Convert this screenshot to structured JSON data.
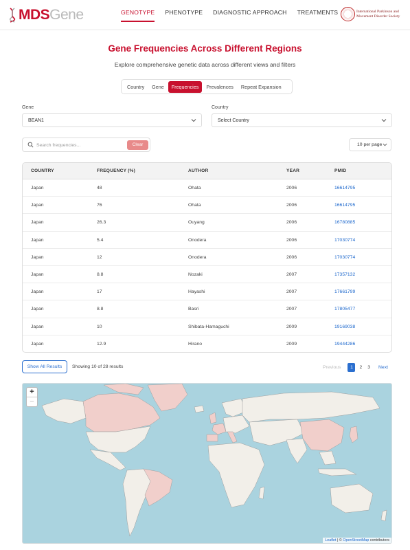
{
  "header": {
    "logo_primary": "MDS",
    "logo_secondary": "Gene",
    "nav": [
      {
        "label": "GENOTYPE",
        "active": true
      },
      {
        "label": "PHENOTYPE",
        "active": false
      },
      {
        "label": "DIAGNOSTIC APPROACH",
        "active": false
      },
      {
        "label": "TREATMENTS",
        "active": false
      }
    ],
    "society": "International Parkinson and Movement Disorder Society"
  },
  "page": {
    "title": "Gene Frequencies Across Different Regions",
    "subtitle": "Explore comprehensive genetic data across different views and filters"
  },
  "tabs": [
    {
      "label": "Country",
      "active": false
    },
    {
      "label": "Gene",
      "active": false
    },
    {
      "label": "Frequencies",
      "active": true
    },
    {
      "label": "Prevalences",
      "active": false
    },
    {
      "label": "Repeat Expansion",
      "active": false
    }
  ],
  "filters": {
    "gene_label": "Gene",
    "gene_value": "BEAN1",
    "country_label": "Country",
    "country_value": "Select Country"
  },
  "search": {
    "placeholder": "Search frequencies...",
    "clear_label": "Clear",
    "per_page": "10 per page"
  },
  "table": {
    "columns": [
      "COUNTRY",
      "FREQUENCY (%)",
      "AUTHOR",
      "YEAR",
      "PMID"
    ],
    "rows": [
      {
        "country": "Japan",
        "frequency": "48",
        "author": "Ohata",
        "year": "2006",
        "pmid": "16614795"
      },
      {
        "country": "Japan",
        "frequency": "76",
        "author": "Ohata",
        "year": "2006",
        "pmid": "16614795"
      },
      {
        "country": "Japan",
        "frequency": "26.3",
        "author": "Ouyang",
        "year": "2006",
        "pmid": "16780885"
      },
      {
        "country": "Japan",
        "frequency": "5.4",
        "author": "Onodera",
        "year": "2006",
        "pmid": "17030774"
      },
      {
        "country": "Japan",
        "frequency": "12",
        "author": "Onodera",
        "year": "2006",
        "pmid": "17030774"
      },
      {
        "country": "Japan",
        "frequency": "8.8",
        "author": "Nozaki",
        "year": "2007",
        "pmid": "17357132"
      },
      {
        "country": "Japan",
        "frequency": "17",
        "author": "Hayashi",
        "year": "2007",
        "pmid": "17661799"
      },
      {
        "country": "Japan",
        "frequency": "8.8",
        "author": "Basri",
        "year": "2007",
        "pmid": "17805477"
      },
      {
        "country": "Japan",
        "frequency": "10",
        "author": "Shibata-Hamaguchi",
        "year": "2009",
        "pmid": "19169038"
      },
      {
        "country": "Japan",
        "frequency": "12.9",
        "author": "Hirano",
        "year": "2009",
        "pmid": "19444286"
      }
    ]
  },
  "pagination": {
    "show_all": "Show All Results",
    "showing": "Showing 10 of 28 results",
    "previous": "Previous",
    "pages": [
      "1",
      "2",
      "3"
    ],
    "current_page": "1",
    "next": "Next"
  },
  "map": {
    "zoom_in": "+",
    "zoom_out": "−",
    "attribution_leaflet": "Leaflet",
    "attribution_sep": " | © ",
    "attribution_osm": "OpenStreetMap",
    "attribution_tail": " contributors",
    "highlighted_regions": [
      "Canada",
      "Greenland",
      "Brazil",
      "United Kingdom",
      "France",
      "Italy",
      "Spain",
      "China",
      "Japan"
    ],
    "colors": {
      "water": "#aad3df",
      "land": "#f2efe9",
      "highlight": "#f1cfcb",
      "border": "#9e9e9e"
    }
  },
  "colors": {
    "accent": "#c8102e",
    "link": "#1a66cc",
    "button_blue": "#2b6fcf"
  }
}
